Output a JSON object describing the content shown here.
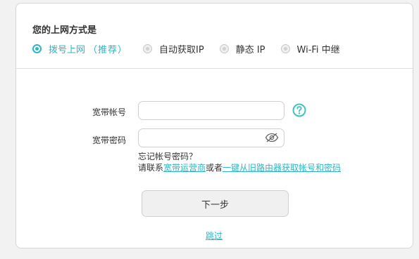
{
  "connection": {
    "title": "您的上网方式是",
    "options": [
      {
        "label": "拨号上网",
        "hint": "（推荐）",
        "selected": true
      },
      {
        "label": "自动获取IP",
        "selected": false
      },
      {
        "label": "静态 IP",
        "selected": false
      },
      {
        "label": "Wi-Fi 中继",
        "selected": false
      }
    ]
  },
  "form": {
    "account_label": "宽带帐号",
    "account_value": "",
    "password_label": "宽带密码",
    "password_value": "",
    "forgot_line1": "忘记帐号密码？",
    "forgot_prefix": "请联系",
    "forgot_isp_link": "宽带运营商",
    "forgot_or": "或者",
    "forgot_old_router_link": "一键从旧路由器获取帐号和密码"
  },
  "actions": {
    "next_label": "下一步",
    "skip_label": "跳过"
  },
  "colors": {
    "accent": "#2eb5c5",
    "help_icon": "#3fc4b9"
  },
  "icons": {
    "help": "question-circle",
    "password_toggle": "eye-slash"
  }
}
